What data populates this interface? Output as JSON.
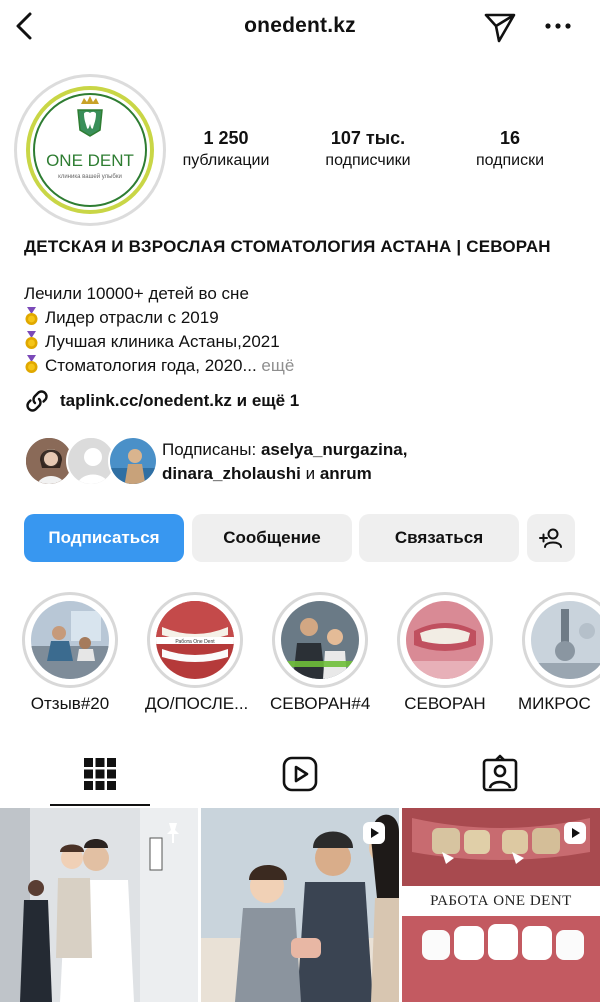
{
  "header": {
    "handle": "onedent.kz"
  },
  "profile": {
    "logo_text": "ONE DENT",
    "logo_tagline": "клиника вашей улыбки",
    "stats": [
      {
        "value": "1 250",
        "label": "публикации"
      },
      {
        "value": "107 тыс.",
        "label": "подписчики"
      },
      {
        "value": "16",
        "label": "подписки"
      }
    ]
  },
  "bio": {
    "name": "ДЕТСКАЯ И ВЗРОСЛАЯ СТОМАТОЛОГИЯ АСТАНА | СЕВОРАН",
    "line1": "Лечили 10000+ детей во сне",
    "line2": "Лидер отрасли с 2019",
    "line3": "Лучшая клиника Астаны,2021",
    "line4": "Стоматология года, 2020...",
    "more": "ещё",
    "link": "taplink.cc/onedent.kz и ещё 1"
  },
  "followed_by": {
    "prefix": "Подписаны:",
    "user1": "aselya_nurgazina,",
    "user2": "dinara_zholaushi",
    "conj": "и",
    "user3": "anrum"
  },
  "actions": {
    "follow": "Подписаться",
    "message": "Сообщение",
    "contact": "Связаться"
  },
  "highlights": [
    {
      "label": "Отзыв#20"
    },
    {
      "label": "ДО/ПОСЛЕ..."
    },
    {
      "label": "СЕВОРАН#4"
    },
    {
      "label": "СЕВОРАН"
    },
    {
      "label": "МИКРОС"
    }
  ],
  "highlight_small_text": "Работа One Dent",
  "grid": {
    "post3_caption": "РАБОТА ONE DENT"
  },
  "colors": {
    "accent": "#3897f0",
    "button_bg": "#efefef",
    "logo_green": "#2e7d32",
    "logo_ring": "#c9d646"
  },
  "icons": [
    "back-icon",
    "send-icon",
    "more-icon",
    "link-icon",
    "add-person-icon",
    "grid-icon",
    "reels-icon",
    "tagged-icon",
    "pin-icon",
    "video-icon",
    "medal-icon"
  ]
}
